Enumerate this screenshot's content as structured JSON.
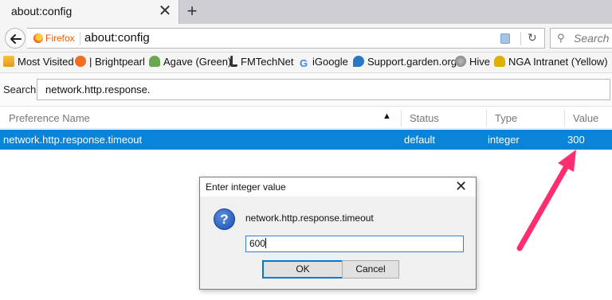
{
  "tab": {
    "title": "about:config"
  },
  "navbar": {
    "identity_label": "Firefox",
    "url": "about:config",
    "search_placeholder": "Search"
  },
  "bookmarks": [
    {
      "label": "Most Visited",
      "icon": "star-icon",
      "color": "#f5a623"
    },
    {
      "label": "| Brightpearl",
      "icon": "orange-circle-icon",
      "color": "#f26d1f"
    },
    {
      "label": "Agave (Green)",
      "icon": "plant-icon",
      "color": "#6aa84f"
    },
    {
      "label": "FMTechNet",
      "icon": "hook-icon",
      "color": "#333333"
    },
    {
      "label": "iGoogle",
      "icon": "google-g-icon",
      "color": "#4285f4"
    },
    {
      "label": "Support.garden.org",
      "icon": "drop-icon",
      "color": "#2b78c2"
    },
    {
      "label": "Hive",
      "icon": "globe-icon",
      "color": "#8a8a8a"
    },
    {
      "label": "NGA Intranet (Yellow)",
      "icon": "plant-icon",
      "color": "#e0b000"
    }
  ],
  "filter": {
    "label": "Search:",
    "value": "network.http.response."
  },
  "table": {
    "columns": [
      "Preference Name",
      "Status",
      "Type",
      "Value"
    ],
    "rows": [
      {
        "name": "network.http.response.timeout",
        "status": "default",
        "type": "integer",
        "value": "300"
      }
    ]
  },
  "dialog": {
    "title": "Enter integer value",
    "message": "network.http.response.timeout",
    "input_value": "600",
    "ok_label": "OK",
    "cancel_label": "Cancel"
  },
  "colors": {
    "selection": "#0a84d9",
    "arrow": "#ff2e6e"
  }
}
